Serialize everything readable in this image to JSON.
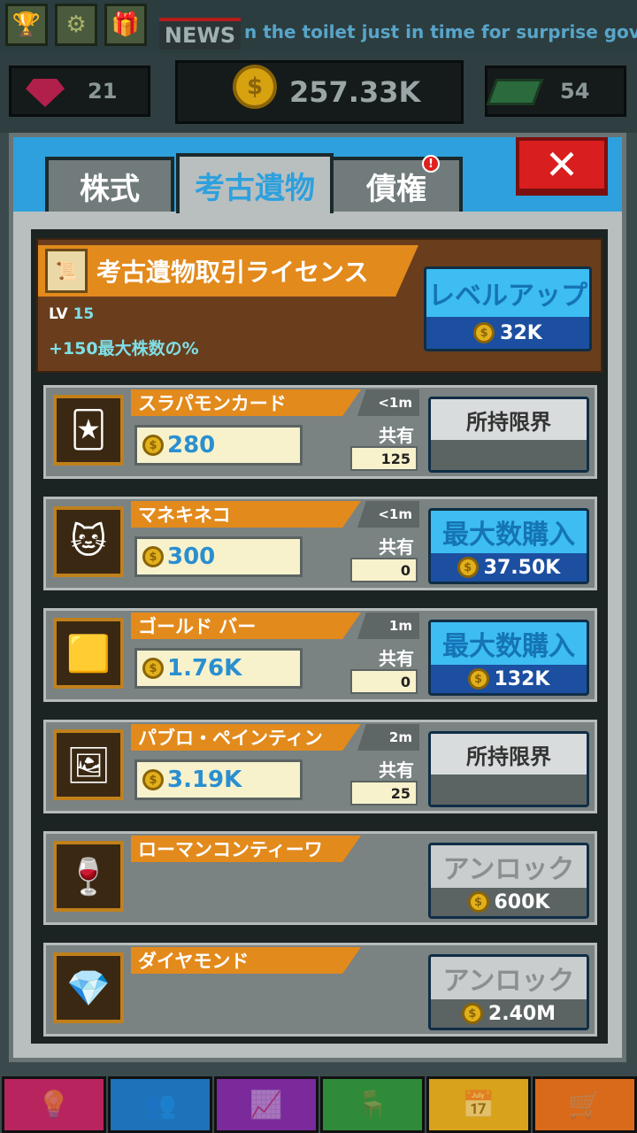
{
  "hud": {
    "buttons": [
      {
        "name": "trophy-button",
        "icon": "trophy-icon",
        "glyph": "🏆"
      },
      {
        "name": "settings-button",
        "icon": "gear-icon",
        "glyph": "⚙"
      },
      {
        "name": "gift-button",
        "icon": "gift-icon",
        "glyph": "🎁"
      }
    ],
    "news_label": "NEWS",
    "news_text": "n the toilet just in time for surprise gover"
  },
  "currencies": {
    "gems": "21",
    "coins": "257.33K",
    "cash": "54",
    "coin_glyph": "$"
  },
  "dialog": {
    "tabs": [
      {
        "label": "株式",
        "active": false
      },
      {
        "label": "考古遺物",
        "active": true
      },
      {
        "label": "債権",
        "active": false,
        "badge": "!"
      }
    ],
    "close_glyph": "✕",
    "license": {
      "title": "考古遺物取引ライセンス",
      "lv_prefix": "LV",
      "lv_value": "15",
      "bonus": "+150最大株数の%",
      "level_up_label": "レベルアップ",
      "level_up_cost": "32K"
    },
    "items": [
      {
        "name": "スラパモンカード",
        "time": "<1m",
        "price": "280",
        "share_label": "共有",
        "shares": "125",
        "button": {
          "type": "limit",
          "label": "所持限界",
          "cost": ""
        },
        "icon": "card-icon",
        "glyph": "🃏"
      },
      {
        "name": "マネキネコ",
        "time": "<1m",
        "price": "300",
        "share_label": "共有",
        "shares": "0",
        "button": {
          "type": "blue",
          "label": "最大数購入",
          "cost": "37.50K"
        },
        "icon": "lucky-cat-icon",
        "glyph": "🐱"
      },
      {
        "name": "ゴールド バー",
        "time": "1m",
        "price": "1.76K",
        "share_label": "共有",
        "shares": "0",
        "button": {
          "type": "blue",
          "label": "最大数購入",
          "cost": "132K"
        },
        "icon": "gold-bar-icon",
        "glyph": "🟨"
      },
      {
        "name": "パブロ・ペインティン",
        "time": "2m",
        "price": "3.19K",
        "share_label": "共有",
        "shares": "25",
        "button": {
          "type": "limit",
          "label": "所持限界",
          "cost": ""
        },
        "icon": "painting-icon",
        "glyph": "🖼"
      },
      {
        "name": "ローマンコンティーワ",
        "time": "",
        "price": "",
        "share_label": "",
        "shares": "",
        "button": {
          "type": "gray",
          "label": "アンロック",
          "cost": "600K"
        },
        "icon": "wine-icon",
        "glyph": "🍷"
      },
      {
        "name": "ダイヤモンド",
        "time": "",
        "price": "",
        "share_label": "",
        "shares": "",
        "button": {
          "type": "gray",
          "label": "アンロック",
          "cost": "2.40M"
        },
        "icon": "diamond-icon",
        "glyph": "💎"
      }
    ]
  },
  "bottom_nav": [
    {
      "name": "nav-ideas",
      "icon": "lightbulb-icon",
      "color": "#b8255e",
      "glyph": "💡"
    },
    {
      "name": "nav-staff",
      "icon": "people-icon",
      "color": "#1e72b8",
      "glyph": "👥"
    },
    {
      "name": "nav-market",
      "icon": "chart-icon",
      "color": "#7a2a9a",
      "glyph": "📈"
    },
    {
      "name": "nav-office",
      "icon": "chair-icon",
      "color": "#2f8a3a",
      "glyph": "🪑"
    },
    {
      "name": "nav-events",
      "icon": "calendar-icon",
      "color": "#d8a21a",
      "glyph": "📅"
    },
    {
      "name": "nav-shop",
      "icon": "cart-icon",
      "color": "#d86a1a",
      "glyph": "🛒"
    }
  ]
}
